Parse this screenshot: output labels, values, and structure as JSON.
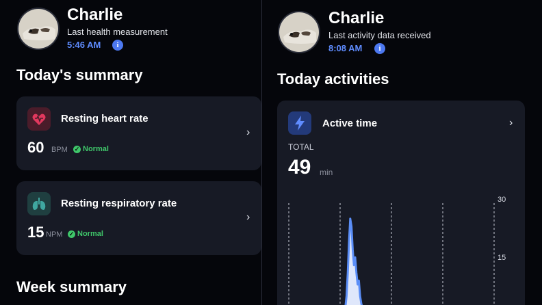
{
  "left": {
    "profile": {
      "name": "Charlie",
      "subtitle": "Last health measurement",
      "time": "5:46 AM"
    },
    "today_title": "Today's summary",
    "cards": [
      {
        "title": "Resting heart rate",
        "value": "60",
        "unit": "BPM",
        "status": "Normal",
        "icon": "heart-icon",
        "color": "#e2385e"
      },
      {
        "title": "Resting respiratory rate",
        "value": "15",
        "unit": "NPM",
        "status": "Normal",
        "icon": "lungs-icon",
        "color": "#3fa7a0"
      }
    ],
    "week_title": "Week summary"
  },
  "right": {
    "profile": {
      "name": "Charlie",
      "subtitle": "Last activity data received",
      "time": "8:08 AM"
    },
    "title": "Today activities",
    "card": {
      "title": "Active time",
      "icon": "lightning-icon",
      "total_label": "TOTAL",
      "total_value": "49",
      "total_unit": "min"
    }
  },
  "chart_data": {
    "type": "area",
    "y_ticks": [
      30,
      15
    ],
    "ylim": [
      0,
      30
    ],
    "x": [
      0,
      1,
      2,
      3,
      4,
      5,
      6,
      7,
      8,
      9,
      10,
      11,
      12,
      13,
      14,
      15,
      16,
      17,
      18,
      19,
      20
    ],
    "values": [
      0,
      1,
      3,
      6,
      12,
      20,
      26,
      24,
      18,
      14,
      16,
      12,
      9,
      10,
      6,
      4,
      3,
      2,
      1,
      0,
      0
    ],
    "color": "#5b8ef7"
  },
  "colors": {
    "accent": "#5f8cff",
    "normal": "#3fc66a"
  }
}
